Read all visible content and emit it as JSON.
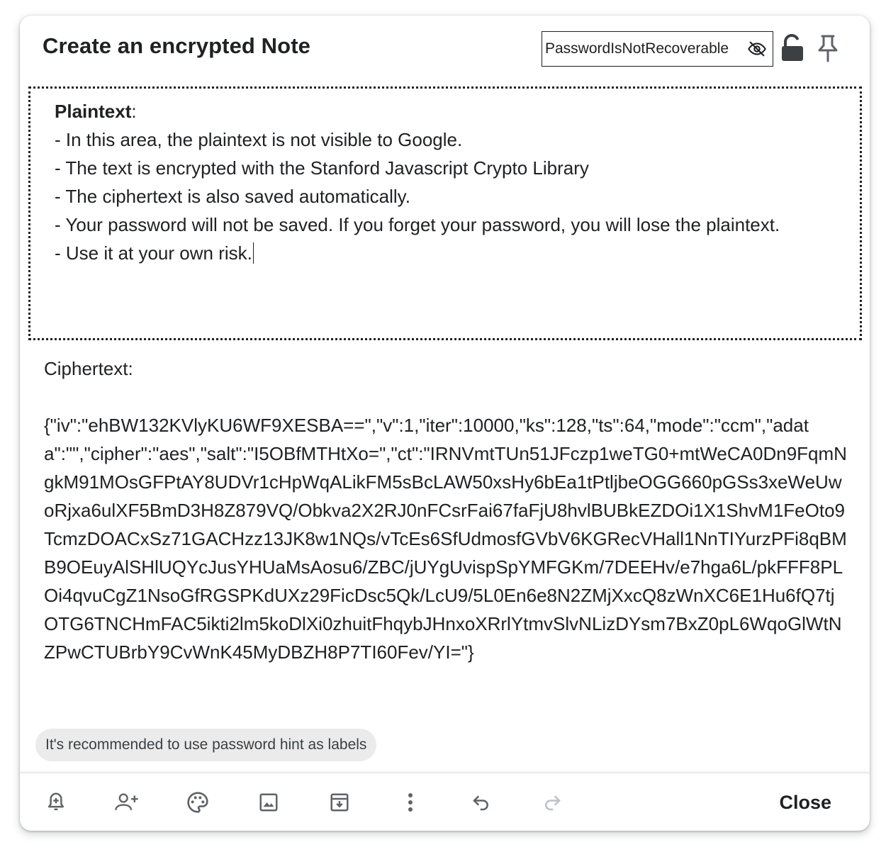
{
  "note": {
    "title": "Create an encrypted Note",
    "password": {
      "value": "PasswordIsNotRecoverable"
    },
    "plaintext": {
      "label": "Plaintext",
      "lines": [
        "- In this area, the plaintext is not visible to Google.",
        "- The text is encrypted with the Stanford Javascript Crypto Library",
        "- The ciphertext is also saved automatically.",
        "- Your password will not be saved. If you forget your password, you will lose the plaintext.",
        "- Use it at your own risk."
      ]
    },
    "ciphertext": {
      "label": "Ciphertext:",
      "value": "{\"iv\":\"ehBW132KVlyKU6WF9XESBA==\",\"v\":1,\"iter\":10000,\"ks\":128,\"ts\":64,\"mode\":\"ccm\",\"adata\":\"\",\"cipher\":\"aes\",\"salt\":\"I5OBfMTHtXo=\",\"ct\":\"IRNVmtTUn51JFczp1weTG0+mtWeCA0Dn9FqmNgkM91MOsGFPtAY8UDVr1cHpWqALikFM5sBcLAW50xsHy6bEa1tPtljbeOGG660pGSs3xeWeUwoRjxa6ulXF5BmD3H8Z879VQ/Obkva2X2RJ0nFCsrFai67faFjU8hvlBUBkEZDOi1X1ShvM1FeOto9TcmzDOACxSz71GACHzz13JK8w1NQs/vTcEs6SfUdmosfGVbV6KGRecVHall1NnTIYurzPFi8qBMB9OEuyAlSHlUQYcJusYHUaMsAosu6/ZBC/jUYgUvispSpYMFGKm/7DEEHv/e7hga6L/pkFFF8PLOi4qvuCgZ1NsoGfRGSPKdUXz29FicDsc5Qk/LcU9/5L0En6e8N2ZMjXxcQ8zWnXC6E1Hu6fQ7tjOTG6TNCHmFAC5ikti2lm5koDlXi0zhuitFhqybJHnxoXRrlYtmvSlvNLizDYsm7BxZ0pL6WqoGlWtNZPwCTUBrbY9CvWnK45MyDBZH8P7TI60Fev/YI=\"}"
    },
    "label_chip": "It's recommended to use password hint as labels"
  },
  "toolbar": {
    "icons": [
      "remind-me-icon",
      "collaborator-icon",
      "palette-icon",
      "image-icon",
      "archive-icon",
      "more-icon",
      "undo-icon",
      "redo-icon"
    ],
    "close_label": "Close"
  },
  "colors": {
    "text": "#202124",
    "chip_bg": "#ebebeb",
    "spellcheck": "#d93025",
    "disabled_icon": "#bdc1c6"
  }
}
